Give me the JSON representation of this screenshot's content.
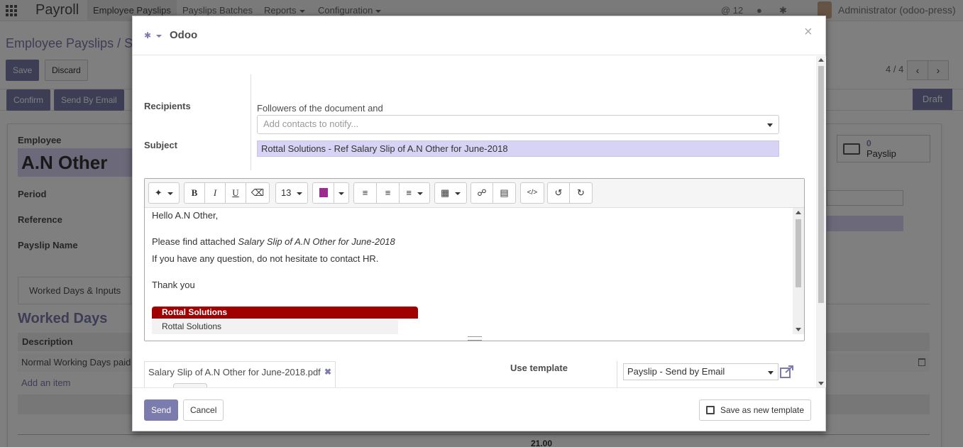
{
  "topbar": {
    "brand": "Payroll",
    "menu": [
      {
        "label": "Employee Payslips"
      },
      {
        "label": "Payslips Batches"
      },
      {
        "label": "Reports"
      },
      {
        "label": "Configuration"
      }
    ],
    "messages_count": "@ 12",
    "user": "Administrator (odoo-press)"
  },
  "page": {
    "breadcrumb": "Employee Payslips /  S",
    "save_label": "Save",
    "discard_label": "Discard",
    "pager": "4 / 4",
    "status_buttons": [
      {
        "label": "Confirm"
      },
      {
        "label": "Send By Email"
      }
    ],
    "status": "Draft",
    "employee_label": "Employee",
    "employee_name": "A.N Other",
    "period_label": "Period",
    "reference_label": "Reference",
    "payslip_name_label": "Payslip Name",
    "payslip_count": "0",
    "payslip_stat_label": "Payslip",
    "tab_label": "Worked Days & Inputs",
    "worked_days_title": "Worked Days",
    "table_header_description": "Description",
    "row_description": "Normal Working Days paid",
    "add_item": "Add an item",
    "total_value": "21.00"
  },
  "dialog": {
    "title": "Odoo",
    "close": "×",
    "recipients_label": "Recipients",
    "followers_text": "Followers of the document and",
    "contacts_placeholder": "Add contacts to notify...",
    "subject_label": "Subject",
    "subject_value": "Rottal Solutions - Ref Salary Slip of A.N Other for June-2018",
    "toolbar": {
      "font_size": "13"
    },
    "body": {
      "greeting": "Hello A.N Other,",
      "line1_prefix": "Please find attached ",
      "line1_italic": "Salary Slip of A.N Other for June-2018",
      "line2": "If you have any question, do not hesitate to contact HR.",
      "thanks": "Thank you",
      "company_banner": "Rottal Solutions",
      "company_name": "Rottal Solutions"
    },
    "attachment_name": "Salary Slip of A.N Other for June-2018.pdf",
    "use_template_label": "Use template",
    "template_value": "Payslip - Send by Email",
    "send_label": "Send",
    "cancel_label": "Cancel",
    "save_template_label": "Save as new template"
  },
  "colors": {
    "accent": "#7c7bad",
    "banner": "#a00000",
    "subject_bg": "#d7d3f5"
  }
}
